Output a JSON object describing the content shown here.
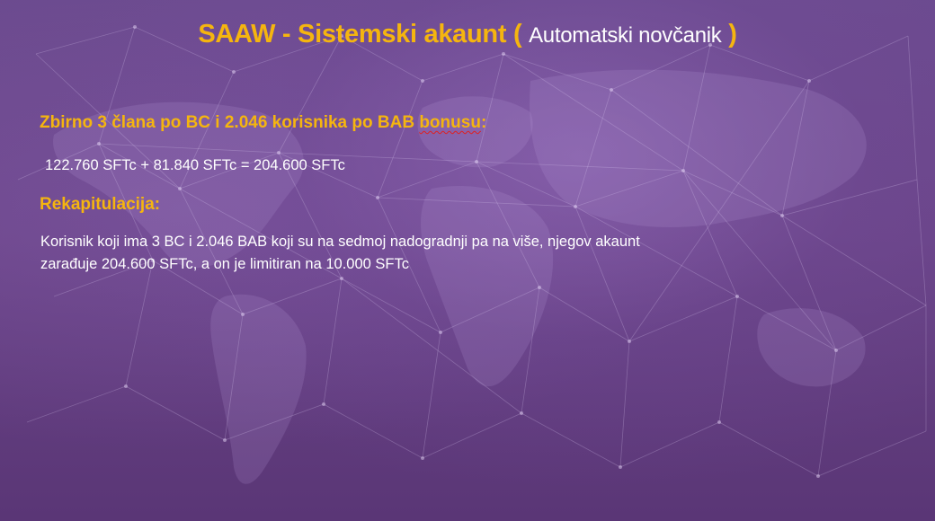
{
  "slide": {
    "title_main": "SAAW - Sistemski akaunt (",
    "title_sub": "Automatski novčanik",
    "title_close": ")",
    "summary_heading_start": "Zbirno 3 člana po BC i 2.046 korisnika po BAB ",
    "summary_heading_flagged": "bonusu",
    "summary_heading_end": ":",
    "formula": "122.760 SFTc + 81.840 SFTc = 204.600 SFTc",
    "recap_heading": "Rekapitulacija:",
    "recap_line_1": "Korisnik koji ima 3 BC i 2.046 BAB koji su na sedmoj nadogradnji pa na više, njegov akaunt",
    "recap_line_2": "zarađuje 204.600 SFTc, a on je limitiran na 10.000 SFTc"
  },
  "colors": {
    "accent": "#f5b50f",
    "text": "#ffffff",
    "background": "#6a4488",
    "spellcheck": "#e02020"
  },
  "background_graphic": "world-map-network"
}
